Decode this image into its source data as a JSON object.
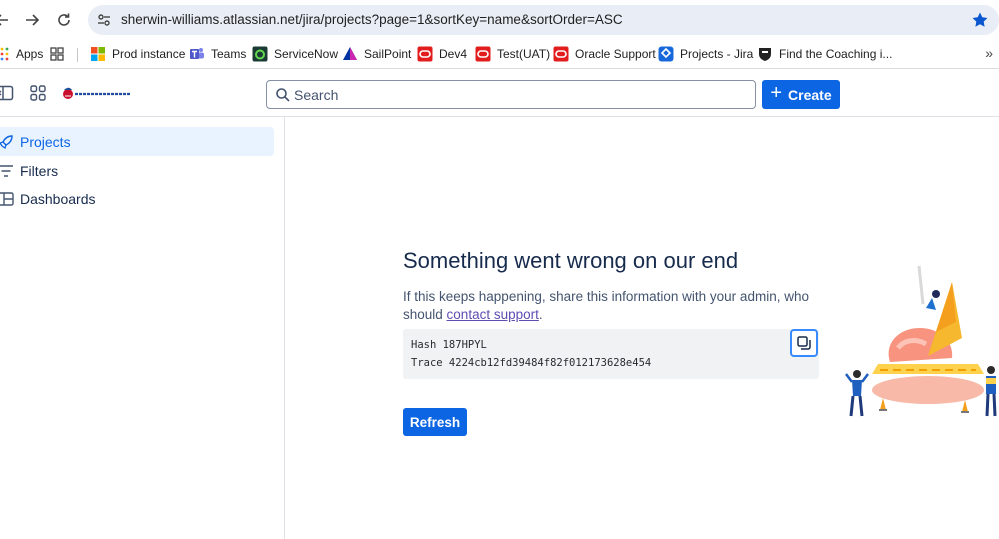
{
  "browser": {
    "url": "sherwin-williams.atlassian.net/jira/projects?page=1&sortKey=name&sortOrder=ASC",
    "bookmarks": [
      {
        "label": "Apps",
        "icon": "apps-grid-icon"
      },
      {
        "label": "",
        "icon": "tab-groups-icon"
      },
      {
        "label": "Prod instance",
        "icon": "microsoft-logo-icon"
      },
      {
        "label": "Teams",
        "icon": "teams-icon"
      },
      {
        "label": "ServiceNow",
        "icon": "servicenow-icon"
      },
      {
        "label": "SailPoint",
        "icon": "sailpoint-icon"
      },
      {
        "label": "Dev4",
        "icon": "oracle-icon"
      },
      {
        "label": "Test(UAT)",
        "icon": "oracle-icon"
      },
      {
        "label": "Oracle Support",
        "icon": "oracle-icon"
      },
      {
        "label": "Projects - Jira",
        "icon": "jira-icon"
      },
      {
        "label": "Find the Coaching i...",
        "icon": "shield-icon"
      }
    ],
    "more_label": "»"
  },
  "header": {
    "search_placeholder": "Search",
    "create_label": "Create",
    "create_plus": "+"
  },
  "sidebar": {
    "items": [
      {
        "label": "Projects",
        "active": true
      },
      {
        "label": "Filters",
        "active": false
      },
      {
        "label": "Dashboards",
        "active": false
      }
    ]
  },
  "error": {
    "title": "Something went wrong on our end",
    "desc_before": "If this keeps happening, share this information with your admin, who should ",
    "link": "contact support",
    "desc_after": ".",
    "hash_line": "Hash 187HPYL",
    "trace_line": "Trace 4224cb12fd39484f82f012173628e454",
    "refresh_label": "Refresh"
  },
  "colors": {
    "brand_blue": "#0c66e4",
    "active_bg": "#e9f2ff",
    "link_purple": "#5e4db2"
  }
}
